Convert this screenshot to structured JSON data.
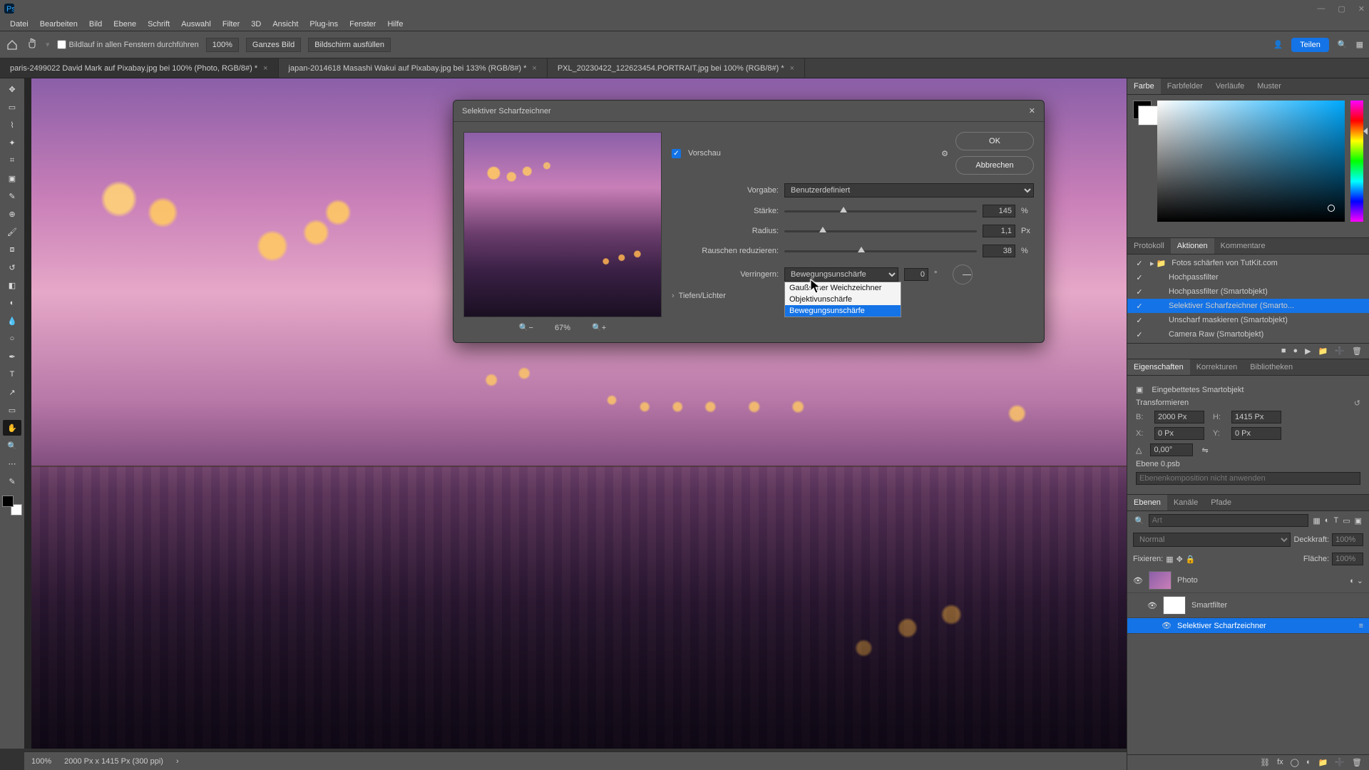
{
  "titlebar": {
    "min": "—",
    "max": "▢",
    "close": "✕"
  },
  "menu": [
    "Datei",
    "Bearbeiten",
    "Bild",
    "Ebene",
    "Schrift",
    "Auswahl",
    "Filter",
    "3D",
    "Ansicht",
    "Plug-ins",
    "Fenster",
    "Hilfe"
  ],
  "options": {
    "scrollAll": "Bildlauf in allen Fenstern durchführen",
    "zoom": "100%",
    "fitAll": "Ganzes Bild",
    "fillScreen": "Bildschirm ausfüllen",
    "share": "Teilen"
  },
  "tabs": [
    {
      "label": "paris-2499022  David Mark auf Pixabay.jpg bei 100% (Photo, RGB/8#) *",
      "active": true
    },
    {
      "label": "japan-2014618 Masashi Wakui auf Pixabay.jpg bei 133% (RGB/8#) *",
      "active": false
    },
    {
      "label": "PXL_20230422_122623454.PORTRAIT.jpg bei 100% (RGB/8#) *",
      "active": false
    }
  ],
  "dialog": {
    "title": "Selektiver Scharfzeichner",
    "preview": "Vorschau",
    "ok": "OK",
    "cancel": "Abbrechen",
    "preset_l": "Vorgabe:",
    "preset_v": "Benutzerdefiniert",
    "amount_l": "Stärke:",
    "amount_v": "145",
    "amount_u": "%",
    "radius_l": "Radius:",
    "radius_v": "1,1",
    "radius_u": "Px",
    "noise_l": "Rauschen reduzieren:",
    "noise_v": "38",
    "noise_u": "%",
    "remove_l": "Verringern:",
    "remove_v": "Bewegungsunschärfe",
    "angle_v": "0",
    "angle_u": "°",
    "dd": [
      "Gaußscher Weichzeichner",
      "Objektivunschärfe",
      "Bewegungsunschärfe"
    ],
    "shadows": "Tiefen/Lichter",
    "zoom": "67%"
  },
  "rightTabs": {
    "color": [
      "Farbe",
      "Farbfelder",
      "Verläufe",
      "Muster"
    ],
    "history": [
      "Protokoll",
      "Aktionen",
      "Kommentare"
    ],
    "props": [
      "Eigenschaften",
      "Korrekturen",
      "Bibliotheken"
    ],
    "layers": [
      "Ebenen",
      "Kanäle",
      "Pfade"
    ]
  },
  "history": {
    "root": "Fotos schärfen von TutKit.com",
    "items": [
      "Hochpassfilter",
      "Hochpassfilter (Smartobjekt)",
      "Selektiver Scharfzeichner (Smarto...",
      "Unscharf maskieren (Smartobjekt)",
      "Camera Raw (Smartobjekt)"
    ],
    "selected": 2
  },
  "props": {
    "embedded": "Eingebettetes Smartobjekt",
    "transform": "Transformieren",
    "w_l": "B:",
    "w_v": "2000 Px",
    "h_l": "H:",
    "h_v": "1415 Px",
    "x_l": "X:",
    "x_v": "0 Px",
    "y_l": "Y:",
    "y_v": "0 Px",
    "angle": "0,00°",
    "file": "Ebene 0.psb",
    "compose": "Ebenenkomposition nicht anwenden"
  },
  "layers": {
    "search_ph": "Art",
    "mode": "Normal",
    "opacity_l": "Deckkraft:",
    "opacity_v": "100%",
    "lock_l": "Fixieren:",
    "fill_l": "Fläche:",
    "fill_v": "100%",
    "items": [
      {
        "name": "Photo",
        "level": 1,
        "thumb": "img",
        "sel": false,
        "fx": true
      },
      {
        "name": "Smartfilter",
        "level": 2,
        "thumb": "w",
        "sel": false
      },
      {
        "name": "Selektiver Scharfzeichner",
        "level": 3,
        "thumb": null,
        "sel": true
      }
    ]
  },
  "status": {
    "zoom": "100%",
    "dims": "2000 Px x 1415 Px (300 ppi)"
  }
}
